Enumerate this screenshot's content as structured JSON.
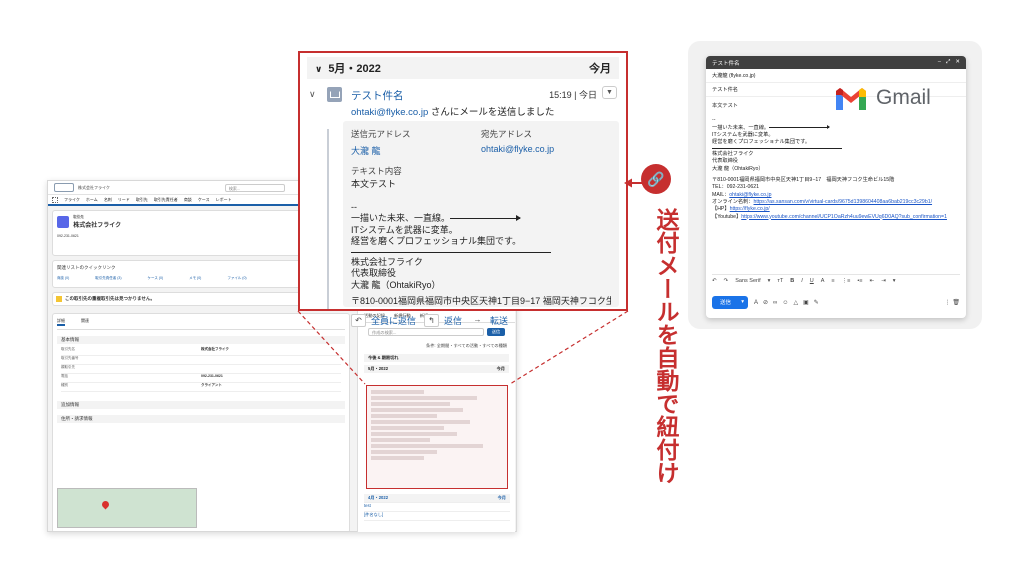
{
  "salesforce": {
    "company_header": "株式会社フライク",
    "search_placeholder": "検索...",
    "app_name": "フライク",
    "nav_items": [
      "ホーム",
      "名刺",
      "リード",
      "取引先",
      "取引先責任者",
      "商談",
      "ケース",
      "レポート"
    ],
    "account_type": "取引先",
    "account_name": "株式会社フライク",
    "phone": "092-231-0621",
    "quick_links_title": "関連リストのクイックリンク",
    "quick_links": [
      "商談 (0)",
      "取引先責任者 (3)",
      "ケース (0)",
      "メモ (0)",
      "ファイル (0)"
    ],
    "warning": "この取引先の重複取引先は見つかりません。",
    "tabs": [
      "詳細",
      "関連"
    ],
    "section_basic": "基本情報",
    "fields": [
      {
        "label": "取引先名",
        "value": "株式会社フライク"
      },
      {
        "label": "取引先番号",
        "value": ""
      },
      {
        "label": "親取引先",
        "value": ""
      },
      {
        "label": "電話",
        "value": "092-231-0621"
      },
      {
        "label": "種別",
        "value": "クライアント"
      }
    ],
    "section_extra": "追加情報",
    "section_address": "住所・請求情報"
  },
  "activity": {
    "tabs": [
      "活動の記録",
      "新規行動",
      "新規ToDo"
    ],
    "search_placeholder": "作成の検索...",
    "search_button": "送信",
    "filter_text": "条件: 全期間・すべての活動・すべての種類",
    "upcoming": "今後 & 期限切れ",
    "group_month": "5月・2022",
    "group_today": "今月",
    "group_later": "4月・2022",
    "later_items": [
      "test",
      "[件名なし]"
    ]
  },
  "email_card": {
    "month_label": "5月・2022",
    "period_label": "今月",
    "subject": "テスト件名",
    "time": "15:19 | 今日",
    "sender_email": "ohtaki@flyke.co.jp",
    "summary_suffix": "さんにメールを送信しました",
    "from_label": "送信元アドレス",
    "from_name": "大瀧 龍",
    "to_label": "宛先アドレス",
    "to_email": "ohtaki@flyke.co.jp",
    "body_label": "テキスト内容",
    "body_lines": [
      "本文テスト",
      "--",
      "一描いた未来、一直線。",
      "ITシステムを武器に変革。",
      "経営を磨くプロフェッショナル集団です。"
    ],
    "sig_lines": [
      "株式会社フライク",
      "代表取締役",
      "大瀧 龍（OhtakiRyo）"
    ],
    "address_line": "〒810-0001福岡県福岡市中央区天神1丁目9−17 福岡天神フコク生命ビ",
    "action_reply_all": "全員に返信",
    "action_reply": "返信",
    "action_forward": "転送"
  },
  "gmail": {
    "window_title": "テスト件名",
    "to_field": "大瀧龍 (flyke.co.jp)",
    "subject_field": "テスト件名",
    "body_lines": [
      "本文テスト",
      "",
      "--",
      "一描いた未来、一直線。",
      "ITシステムを武器に変革。",
      "経営を磨くプロフェッショナル集団です。"
    ],
    "sig_lines": [
      "株式会社フライク",
      "代表取締役",
      "大瀧 龍（OhtakiRyo）"
    ],
    "address": "〒810-0001福岡県福岡市中央区天神1丁目9−17　福岡天神フコク生命ビル15階",
    "tel": "TEL：092-231-0621",
    "mail_label": "MAIL：",
    "mail_value": "ohtaki@flyke.co.jp",
    "online_label": "オンライン名刺：",
    "online_value": "https://as.sansan.com/v/virtual-cards/9675d1398604408aa6bab219cc3c29b1/",
    "hp_label": "【HP】",
    "hp_value": "https://flyke.co.jp/",
    "yt_label": "【Youtube】",
    "yt_value": "https://www.youtube.com/channel/UCP1OaRzh4uu9ewEVUq6D0AQ?sub_confirmation=1",
    "font_name": "Sans Serif",
    "send_label": "送信",
    "brand": "Gmail"
  },
  "caption": "送付メールを自動で紐付け",
  "colors": {
    "accent_red": "#c62f2f",
    "link_blue": "#1b5fa8",
    "gmail_blue": "#1a73e8"
  }
}
